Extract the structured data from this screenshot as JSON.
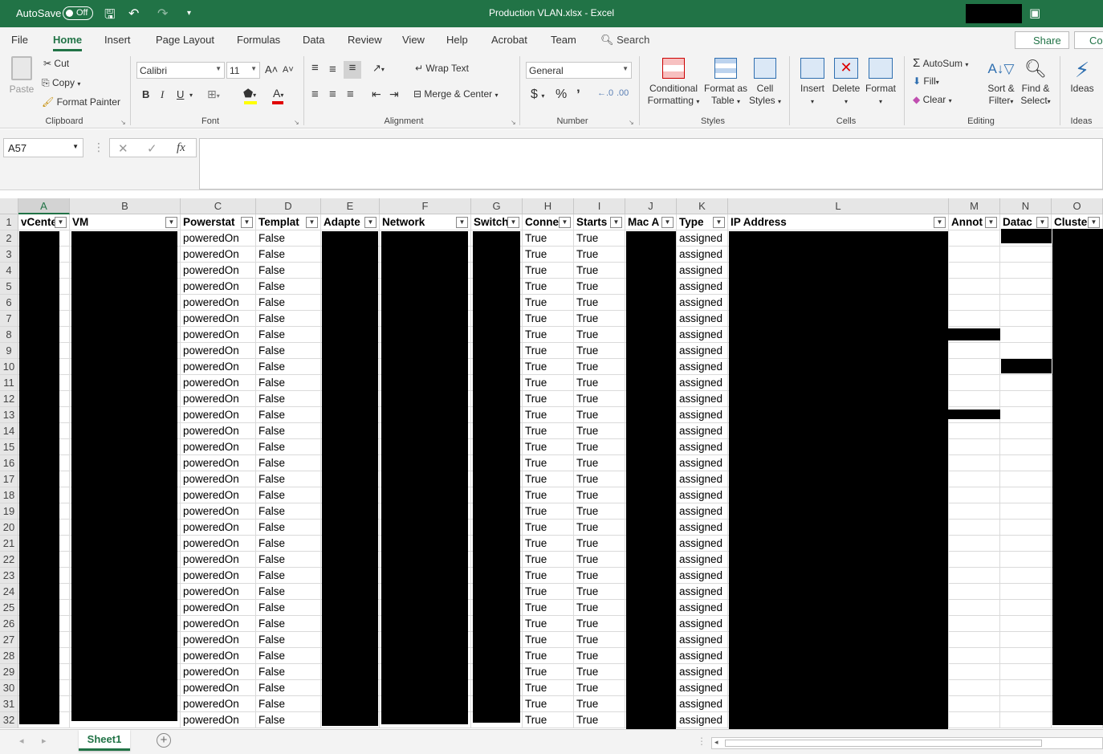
{
  "titlebar": {
    "autosave_label": "AutoSave",
    "autosave_state": "Off",
    "title": "Production VLAN.xlsx  -  Excel",
    "brand_color": "#217346"
  },
  "tabs": [
    "File",
    "Home",
    "Insert",
    "Page Layout",
    "Formulas",
    "Data",
    "Review",
    "View",
    "Help",
    "Acrobat",
    "Team"
  ],
  "active_tab": "Home",
  "search_label": "Search",
  "share_label": "Share",
  "comments_label": "Co",
  "ribbon": {
    "clipboard": {
      "label": "Clipboard",
      "paste": "Paste",
      "cut": "Cut",
      "copy": "Copy",
      "format_painter": "Format Painter"
    },
    "font": {
      "label": "Font",
      "name": "Calibri",
      "size": "11",
      "bold": "B",
      "italic": "I",
      "underline": "U"
    },
    "alignment": {
      "label": "Alignment",
      "wrap_text": "Wrap Text",
      "merge_center": "Merge & Center"
    },
    "number": {
      "label": "Number",
      "format": "General"
    },
    "styles": {
      "label": "Styles",
      "conditional": [
        "Conditional",
        "Formatting"
      ],
      "format_table": [
        "Format as",
        "Table"
      ],
      "cell_styles": [
        "Cell",
        "Styles"
      ]
    },
    "cells": {
      "label": "Cells",
      "insert": "Insert",
      "delete": "Delete",
      "format": "Format"
    },
    "editing": {
      "label": "Editing",
      "autosum": "AutoSum",
      "fill": "Fill",
      "clear": "Clear",
      "sort": [
        "Sort &",
        "Filter"
      ],
      "find": [
        "Find &",
        "Select"
      ]
    },
    "ideas": {
      "label": "Ideas",
      "button": "Ideas"
    }
  },
  "namebox": "A57",
  "columns": [
    "A",
    "B",
    "C",
    "D",
    "E",
    "F",
    "G",
    "H",
    "I",
    "J",
    "K",
    "L",
    "M",
    "N",
    "O"
  ],
  "headers": [
    "vCente",
    "VM",
    "Powerstat",
    "Templat",
    "Adapte",
    "Network",
    "Switch",
    "Conne",
    "Starts",
    "Mac A",
    "Type",
    "IP Address",
    "Annot",
    "Datac",
    "Cluste"
  ],
  "rows_count": 31,
  "row_values": {
    "C": "poweredOn",
    "D": "False",
    "H": "True",
    "I": "True",
    "K": "assigned"
  },
  "sheet_name": "Sheet1"
}
